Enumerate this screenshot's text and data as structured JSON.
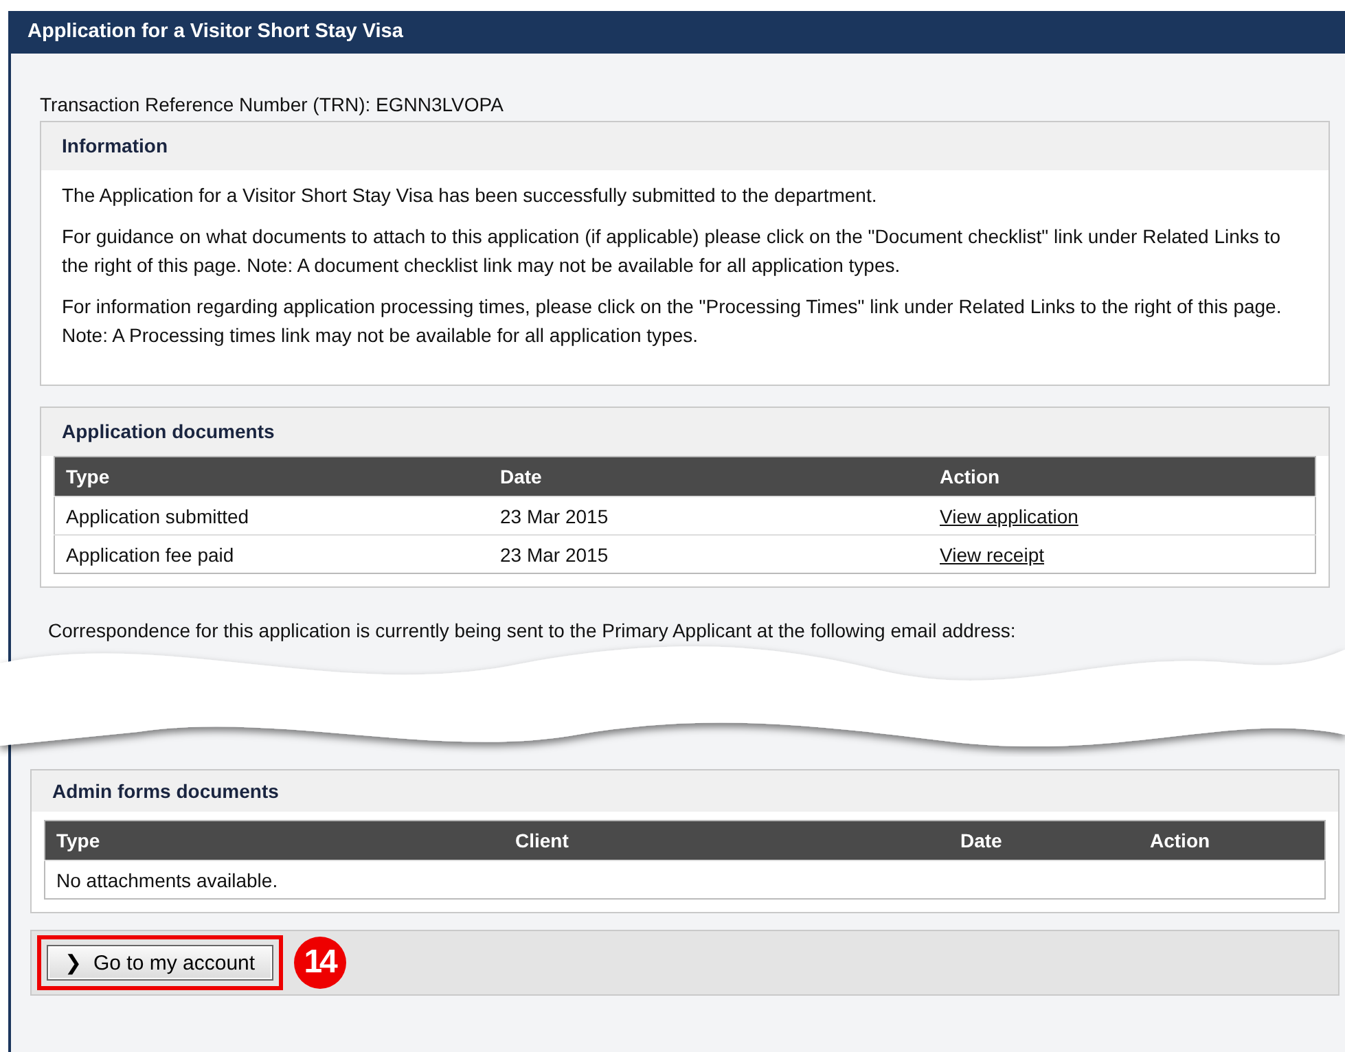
{
  "window": {
    "title": "Application for a Visitor Short Stay Visa"
  },
  "trn": "Transaction Reference Number (TRN): EGNN3LVOPA",
  "information": {
    "title": "Information",
    "paragraphs": [
      "The Application for a Visitor Short Stay Visa has been successfully submitted to the department.",
      "For guidance on what documents to attach to this application (if applicable) please click on the \"Document checklist\" link under Related Links to the right of this page. Note: A document checklist link may not be available for all application types.",
      "For information regarding application processing times, please click on the \"Processing Times\" link under Related Links to the right of this page. Note: A Processing times link may not be available for all application types."
    ]
  },
  "application_documents": {
    "title": "Application documents",
    "columns": [
      "Type",
      "Date",
      "Action"
    ],
    "rows": [
      {
        "type": "Application submitted",
        "date": "23 Mar 2015",
        "action": "View application"
      },
      {
        "type": "Application fee paid",
        "date": "23 Mar 2015",
        "action": "View receipt"
      }
    ]
  },
  "correspondence": "Correspondence for this application is currently being sent to the Primary Applicant at the following email address:",
  "admin_forms_documents": {
    "title": "Admin forms documents",
    "columns": [
      "Type",
      "Client",
      "Date",
      "Action"
    ],
    "empty_message": "No attachments available."
  },
  "button": {
    "icon": "❯",
    "label": "Go to my account"
  },
  "callout": "14"
}
